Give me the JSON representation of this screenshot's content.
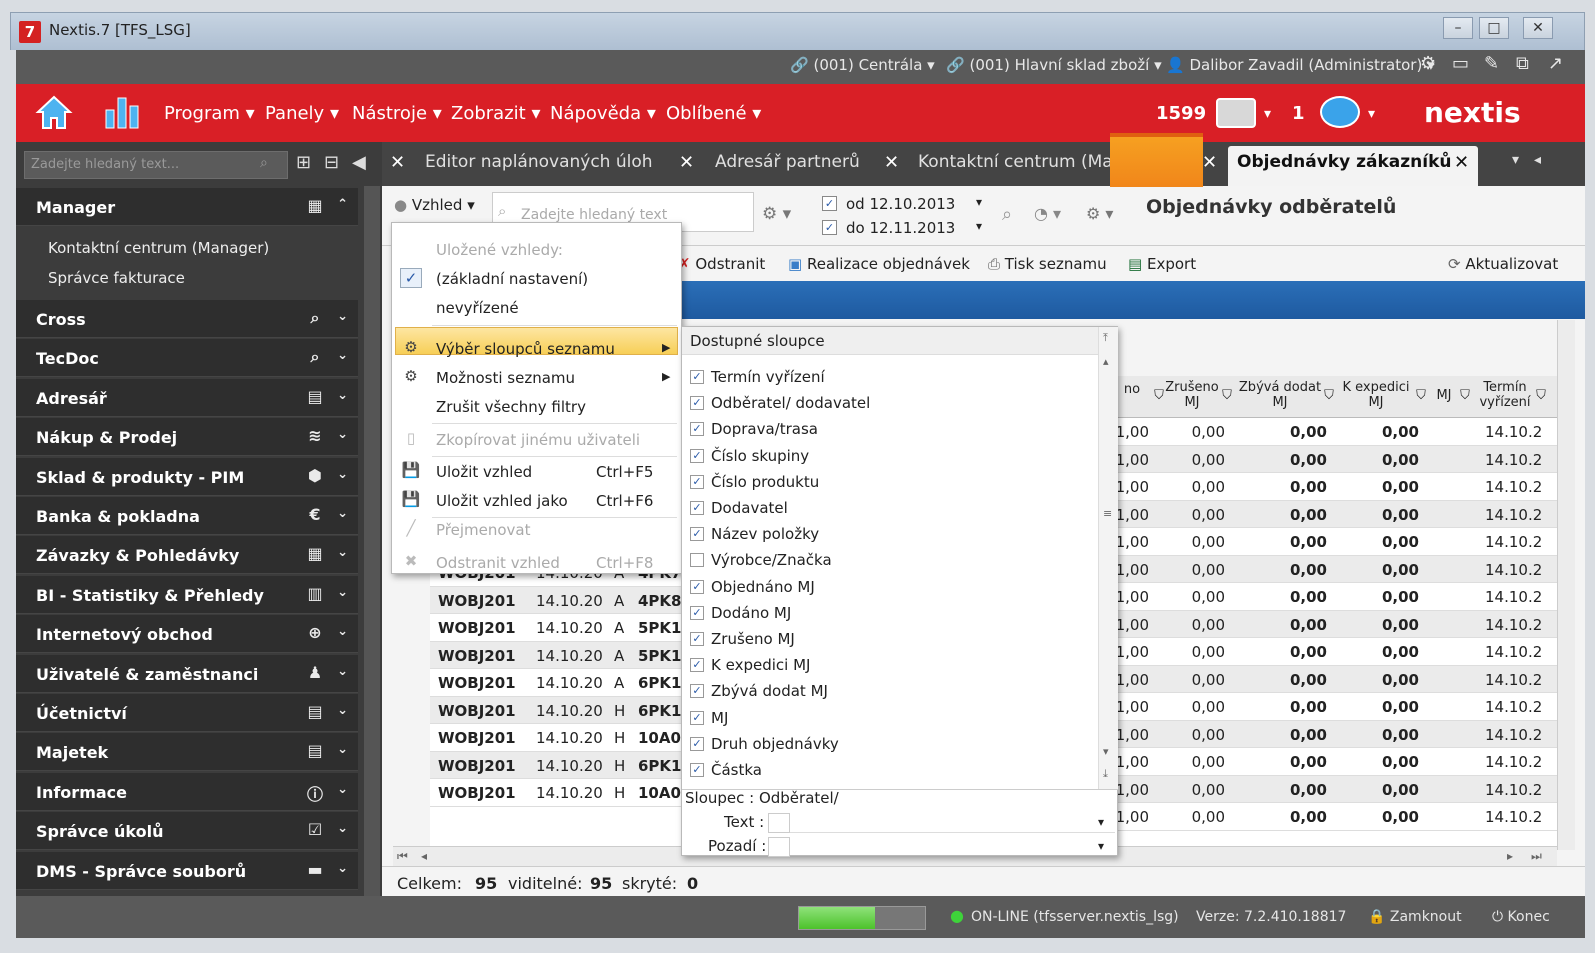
{
  "window": {
    "title": "Nextis.7 [TFS_LSG]",
    "app_icon": "7"
  },
  "topbar": {
    "branch": "(001) Centrála",
    "warehouse": "(001) Hlavní sklad zboží",
    "user": "Dalibor Zavadil (Administrator)"
  },
  "menu": {
    "items": [
      "Program",
      "Panely",
      "Nástroje",
      "Zobrazit",
      "Nápověda",
      "Oblíbené"
    ],
    "counter1": "1599",
    "counter2": "1",
    "brand": "nextis"
  },
  "sidebar": {
    "search_placeholder": "Zadejte hledaný text...",
    "manager": {
      "label": "Manager",
      "subitems": [
        "Kontaktní centrum (Manager)",
        "Správce fakturace"
      ]
    },
    "sections": [
      {
        "label": "Cross",
        "icon": "search-icon"
      },
      {
        "label": "TecDoc",
        "icon": "search-icon"
      },
      {
        "label": "Adresář",
        "icon": "contact-card-icon"
      },
      {
        "label": "Nákup & Prodej",
        "icon": "layers-icon"
      },
      {
        "label": "Sklad & produkty - PIM",
        "icon": "box-icon"
      },
      {
        "label": "Banka & pokladna",
        "icon": "euro-icon"
      },
      {
        "label": "Závazky & Pohledávky",
        "icon": "calculator-icon"
      },
      {
        "label": "BI - Statistiky & Přehledy",
        "icon": "bar-chart-icon"
      },
      {
        "label": "Internetový obchod",
        "icon": "globe-icon"
      },
      {
        "label": "Uživatelé & zaměstnanci",
        "icon": "user-icon"
      },
      {
        "label": "Účetnictví",
        "icon": "ledger-icon"
      },
      {
        "label": "Majetek",
        "icon": "ledger-icon"
      },
      {
        "label": "Informace",
        "icon": "info-icon"
      },
      {
        "label": "Správce úkolů",
        "icon": "checkbox-icon"
      },
      {
        "label": "DMS - Správce souborů",
        "icon": "folder-icon"
      }
    ]
  },
  "tabs": [
    {
      "label": "Editor naplánovaných úloh"
    },
    {
      "label": "Adresář partnerů"
    },
    {
      "label": "Kontaktní centrum (Manager)"
    },
    {
      "label": "Objednávky zákazníků",
      "active": true
    }
  ],
  "toolbar": {
    "view_label": "Vzhled",
    "search_placeholder": "Zadejte hledaný text",
    "date_from": "od 12.10.2013",
    "date_to": "do 12.11.2013",
    "page_title": "Objednávky odběratelů",
    "actions": [
      "Odstranit",
      "Realizace objednávek",
      "Tisk seznamu",
      "Export",
      "Aktualizovat"
    ]
  },
  "view_menu": {
    "saved_header": "Uložené vzhledy:",
    "saved": [
      "(základní nastavení)",
      "nevyřízené"
    ],
    "items": [
      {
        "label": "Výběr sloupců seznamu",
        "shortcut": "",
        "disabled": false,
        "submenu": true
      },
      {
        "label": "Možnosti seznamu",
        "shortcut": "",
        "disabled": false,
        "submenu": true
      },
      {
        "label": "Zrušit všechny filtry",
        "shortcut": "",
        "disabled": false
      },
      {
        "label": "Zkopírovat jinému uživateli",
        "shortcut": "",
        "disabled": true
      },
      {
        "label": "Uložit vzhled",
        "shortcut": "Ctrl+F5",
        "disabled": false
      },
      {
        "label": "Uložit vzhled jako",
        "shortcut": "Ctrl+F6",
        "disabled": false
      },
      {
        "label": "Přejmenovat",
        "shortcut": "",
        "disabled": true
      },
      {
        "label": "Odstranit vzhled",
        "shortcut": "Ctrl+F8",
        "disabled": true
      }
    ]
  },
  "columns_menu": {
    "header": "Dostupné sloupce",
    "columns": [
      {
        "label": "Termín vyřízení",
        "checked": true
      },
      {
        "label": "Odběratel/ dodavatel",
        "checked": true
      },
      {
        "label": "Doprava/trasa",
        "checked": true
      },
      {
        "label": "Číslo skupiny",
        "checked": true
      },
      {
        "label": "Číslo produktu",
        "checked": true
      },
      {
        "label": "Dodavatel",
        "checked": true
      },
      {
        "label": "Název položky",
        "checked": true
      },
      {
        "label": "Výrobce/Značka",
        "checked": false
      },
      {
        "label": "Objednáno MJ",
        "checked": true
      },
      {
        "label": "Dodáno MJ",
        "checked": true
      },
      {
        "label": "Zrušeno MJ",
        "checked": true
      },
      {
        "label": "K expedici MJ",
        "checked": true
      },
      {
        "label": "Zbývá dodat MJ",
        "checked": true
      },
      {
        "label": "MJ",
        "checked": true
      },
      {
        "label": "Druh objednávky",
        "checked": true
      },
      {
        "label": "Částka",
        "checked": true
      }
    ],
    "footer_label": "Sloupec : Odběratel/",
    "text_label": "Text :",
    "bg_label": "Pozadí :"
  },
  "grid": {
    "left_rows": [
      [
        "WOBJ201",
        "14.10.20",
        "A",
        "4PK7"
      ],
      [
        "WOBJ201",
        "14.10.20",
        "A",
        "4PK8"
      ],
      [
        "WOBJ201",
        "14.10.20",
        "A",
        "5PK1"
      ],
      [
        "WOBJ201",
        "14.10.20",
        "A",
        "5PK1"
      ],
      [
        "WOBJ201",
        "14.10.20",
        "A",
        "6PK1"
      ],
      [
        "WOBJ201",
        "14.10.20",
        "H",
        "6PK1"
      ],
      [
        "WOBJ201",
        "14.10.20",
        "H",
        "10A0"
      ],
      [
        "WOBJ201",
        "14.10.20",
        "H",
        "6PK1"
      ],
      [
        "WOBJ201",
        "14.10.20",
        "H",
        "10A0"
      ]
    ],
    "headers": [
      "no",
      "Zrušeno MJ",
      "Zbývá dodat MJ",
      "K expedici MJ",
      "MJ",
      "Termín vyřízení"
    ],
    "right_row": [
      "1,00",
      "0,00",
      "0,00",
      "0,00",
      "14.10.2"
    ],
    "right_row_count": 15
  },
  "footer": {
    "total_label": "Celkem:",
    "total": "95",
    "visible_label": "viditelné:",
    "visible": "95",
    "hidden_label": "skryté:",
    "hidden": "0"
  },
  "status": {
    "online": "ON-LINE (tfsserver.nextis_lsg)",
    "version": "Verze: 7.2.410.18817",
    "lock": "Zamknout",
    "exit": "Konec",
    "progress": 0.6
  }
}
